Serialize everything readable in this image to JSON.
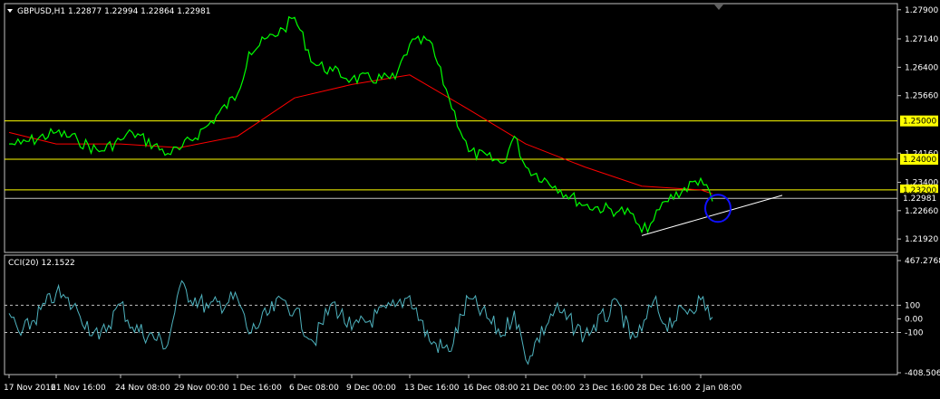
{
  "chart_data": [
    {
      "type": "line",
      "title": "GBPUSD,H1  1.22877 1.22994 1.22864 1.22981",
      "symbol": "GBPUSD",
      "timeframe": "H1",
      "ohlc": {
        "open": 1.22877,
        "high": 1.22994,
        "low": 1.22864,
        "close": 1.22981
      },
      "ylim": [
        1.2157,
        1.2806
      ],
      "y_ticks": [
        "1.27900",
        "1.27140",
        "1.26400",
        "1.25660",
        "1.24160",
        "1.23400",
        "1.22660",
        "1.21920"
      ],
      "horizontal_lines": [
        {
          "value": 1.25,
          "label": "1.25000",
          "color": "#ffff00"
        },
        {
          "value": 1.24,
          "label": "1.24000",
          "color": "#ffff00"
        },
        {
          "value": 1.232,
          "label": "1.23200",
          "color": "#ffff00"
        },
        {
          "value": 1.22981,
          "label": "1.22981",
          "color": "#c0c0c0"
        }
      ],
      "trendline": {
        "from": {
          "x": "28 Dec 2016",
          "y": 1.2201
        },
        "to": {
          "x": "3 Jan 2017",
          "y": 1.2306
        },
        "color": "#ffffff"
      },
      "marker": {
        "shape": "circle",
        "x": "2 Jan 2017",
        "y": 1.2272,
        "color": "#1010ff"
      },
      "series": [
        {
          "role": "price",
          "color": "#00ff00",
          "x": [
            "17 Nov 2016",
            "18 Nov 2016",
            "21 Nov 2016",
            "22 Nov 2016",
            "23 Nov 2016",
            "24 Nov 2016",
            "25 Nov 2016",
            "28 Nov 2016",
            "29 Nov 2016",
            "30 Nov 2016",
            "1 Dec 2016",
            "2 Dec 2016",
            "5 Dec 2016",
            "6 Dec 2016",
            "7 Dec 2016",
            "8 Dec 2016",
            "9 Dec 2016",
            "12 Dec 2016",
            "13 Dec 2016",
            "14 Dec 2016",
            "15 Dec 2016",
            "16 Dec 2016",
            "19 Dec 2016",
            "20 Dec 2016",
            "21 Dec 2016",
            "22 Dec 2016",
            "23 Dec 2016",
            "26 Dec 2016",
            "27 Dec 2016",
            "28 Dec 2016",
            "29 Dec 2016",
            "30 Dec 2016",
            "2 Jan 2017",
            "3 Jan 2017"
          ],
          "values": [
            1.244,
            1.244,
            1.247,
            1.245,
            1.242,
            1.245,
            1.247,
            1.2415,
            1.2425,
            1.249,
            1.257,
            1.268,
            1.274,
            1.277,
            1.265,
            1.263,
            1.261,
            1.261,
            1.27,
            1.271,
            1.256,
            1.242,
            1.239,
            1.246,
            1.238,
            1.233,
            1.228,
            1.2265,
            1.226,
            1.221,
            1.224,
            1.229,
            1.235,
            1.229
          ]
        },
        {
          "role": "moving-average",
          "color": "#ff0000",
          "x": [
            "17 Nov 2016",
            "21 Nov 2016",
            "24 Nov 2016",
            "29 Nov 2016",
            "1 Dec 2016",
            "6 Dec 2016",
            "9 Dec 2016",
            "13 Dec 2016",
            "16 Dec 2016",
            "21 Dec 2016",
            "23 Dec 2016",
            "28 Dec 2016",
            "2 Jan 2017",
            "3 Jan 2017"
          ],
          "values": [
            1.247,
            1.244,
            1.244,
            1.243,
            1.246,
            1.256,
            1.2595,
            1.262,
            1.253,
            1.244,
            1.238,
            1.233,
            1.232,
            1.231
          ]
        }
      ]
    },
    {
      "type": "line",
      "title": "CCI(20) 12.1522",
      "indicator": "CCI(20)",
      "current_value": 12.1522,
      "ylim": [
        -408.5069,
        467.2768
      ],
      "y_ticks": [
        "467.2768",
        "100",
        "0.00",
        "-100",
        "-408.5069"
      ],
      "levels": [
        100,
        -100
      ],
      "series": [
        {
          "role": "cci",
          "color": "#4fb3bf",
          "x": [
            "17 Nov 2016",
            "18 Nov 2016",
            "21 Nov 2016",
            "22 Nov 2016",
            "23 Nov 2016",
            "24 Nov 2016",
            "25 Nov 2016",
            "28 Nov 2016",
            "29 Nov 2016",
            "30 Nov 2016",
            "1 Dec 2016",
            "2 Dec 2016",
            "5 Dec 2016",
            "6 Dec 2016",
            "7 Dec 2016",
            "8 Dec 2016",
            "9 Dec 2016",
            "12 Dec 2016",
            "13 Dec 2016",
            "14 Dec 2016",
            "15 Dec 2016",
            "16 Dec 2016",
            "19 Dec 2016",
            "20 Dec 2016",
            "21 Dec 2016",
            "22 Dec 2016",
            "23 Dec 2016",
            "26 Dec 2016",
            "27 Dec 2016",
            "28 Dec 2016",
            "29 Dec 2016",
            "30 Dec 2016",
            "2 Jan 2017",
            "3 Jan 2017"
          ],
          "values": [
            40,
            -120,
            190,
            60,
            -150,
            110,
            -60,
            -190,
            230,
            80,
            150,
            -110,
            140,
            60,
            -170,
            120,
            -80,
            90,
            170,
            -160,
            -240,
            150,
            -120,
            60,
            -300,
            70,
            -120,
            110,
            -150,
            -90,
            130,
            -40,
            140,
            12
          ]
        }
      ],
      "x_tick_labels": [
        "17 Nov 2016",
        "21 Nov 16:00",
        "24 Nov 08:00",
        "29 Nov 00:00",
        "1 Dec 16:00",
        "6 Dec 08:00",
        "9 Dec 00:00",
        "13 Dec 16:00",
        "16 Dec 08:00",
        "21 Dec 00:00",
        "23 Dec 16:00",
        "28 Dec 16:00",
        "2 Jan 08:00"
      ]
    }
  ]
}
